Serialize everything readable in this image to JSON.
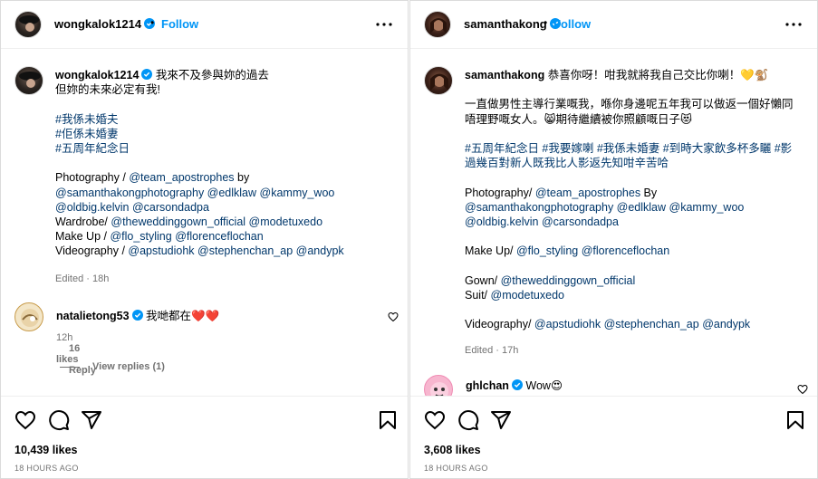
{
  "left": {
    "username": "wongkalok1214",
    "follow_label": "Follow",
    "dot": "•",
    "caption_user": "wongkalok1214",
    "caption_lines": [
      {
        "text": " 我來不及參與妳的過去",
        "link": false
      },
      {
        "text": "但妳的未來必定有我!",
        "link": false
      },
      {
        "text": "",
        "link": false
      },
      {
        "text": "#我係未婚夫",
        "link": true
      },
      {
        "text": "#佢係未婚妻",
        "link": true
      },
      {
        "text": "#五周年紀念日",
        "link": true
      },
      {
        "text": "",
        "link": false
      },
      {
        "text": "Photography / @team_apostrophes by",
        "link": false
      },
      {
        "text": "@samanthakongphotography @edlklaw @kammy_woo",
        "link": true
      },
      {
        "text": "@oldbig.kelvin @carsondadpa",
        "link": true
      },
      {
        "text": "Wardrobe/ @theweddinggown_official @modetuxedo",
        "link": false
      },
      {
        "text": "Make Up / @flo_styling @florenceflochan",
        "link": false
      },
      {
        "text": "Videography / @apstudiohk @stephenchan_ap @andypk",
        "link": false
      }
    ],
    "edited": "Edited · 18h",
    "comment": {
      "user": "natalietong53",
      "text": " 我哋都在",
      "emoji": "❤️❤️",
      "time": "12h",
      "likes": "16 likes",
      "reply": "Reply"
    },
    "view_replies": "View replies (1)",
    "likes": "10,439 likes",
    "ago": "18 HOURS AGO"
  },
  "right": {
    "username": "samanthakong",
    "follow_label": "Follow",
    "dot": "•",
    "caption_user": "samanthakong",
    "caption_first": " 恭喜你呀！咁我就將我自己交比你喇！💛🐒",
    "caption_lines": [
      {
        "text": "",
        "link": false
      },
      {
        "text": "一直做男性主導行業嘅我，喺你身邊呢五年我可以做返一個好懶同",
        "link": false
      },
      {
        "text": "唔理野嘅女人。😸期待繼續被你照顧嘅日子😻",
        "link": false
      },
      {
        "text": "",
        "link": false
      },
      {
        "text": "#五周年紀念日 #我要嫁喇 #我係未婚妻 #到時大家飲多杯多矖 #影",
        "link": true
      },
      {
        "text": "過幾百對新人既我比人影返先知咁辛苦哈",
        "link": true
      },
      {
        "text": "",
        "link": false
      },
      {
        "text": "Photography/ @team_apostrophes By",
        "link": false
      },
      {
        "text": "@samanthakongphotography @edlklaw @kammy_woo",
        "link": true
      },
      {
        "text": "@oldbig.kelvin @carsondadpa",
        "link": true
      },
      {
        "text": "",
        "link": false
      },
      {
        "text": "Make Up/ @flo_styling @florenceflochan",
        "link": false
      },
      {
        "text": "",
        "link": false
      },
      {
        "text": "Gown/ @theweddinggown_official",
        "link": false
      },
      {
        "text": "Suit/ @modetuxedo",
        "link": false
      },
      {
        "text": "",
        "link": false
      },
      {
        "text": "Videography/ @apstudiohk @stephenchan_ap @andypk",
        "link": false
      }
    ],
    "edited": "Edited · 17h",
    "comment": {
      "user": "ghlchan",
      "text": " Wow",
      "emoji": "😍"
    },
    "likes": "3,608 likes",
    "ago": "18 HOURS AGO"
  },
  "colors": {
    "accent": "#0095f6",
    "link": "#00376b",
    "muted": "#737373",
    "heart": "#ed1c24"
  },
  "icons": [
    "verified-badge-icon",
    "more-options-icon",
    "heart-icon",
    "comment-icon",
    "share-icon",
    "bookmark-icon"
  ]
}
